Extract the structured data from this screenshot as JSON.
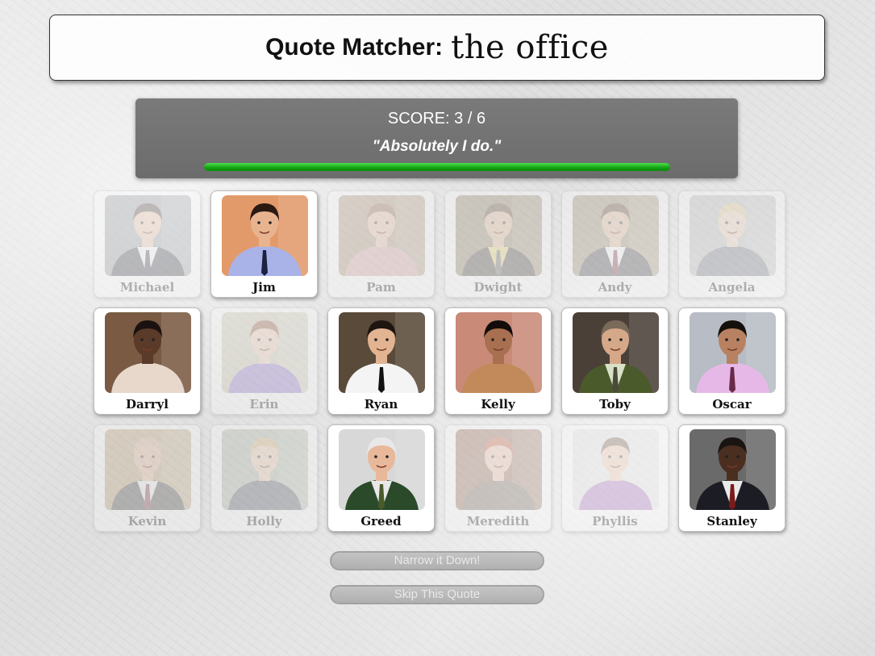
{
  "header": {
    "title_prefix": "Quote Matcher:",
    "title_show": "the office"
  },
  "game": {
    "score": "SCORE: 3 / 6",
    "quote": "\"Absolutely I do.\"",
    "progress": 1.0
  },
  "characters": [
    {
      "name": "Michael",
      "active": false,
      "bg": "#8a8f96",
      "skin": "#e3b89a",
      "hair": "#3b2a20",
      "shirt": "#f2f2f2",
      "suit": "#2c2f38",
      "tie": "#2a2a3a"
    },
    {
      "name": "Jim",
      "active": true,
      "bg": "#e39a6b",
      "skin": "#e8b48f",
      "hair": "#2a1a12",
      "shirt": "#a9b3e8",
      "suit": "#a9b3e8",
      "tie": "#1c2140"
    },
    {
      "name": "Pam",
      "active": false,
      "bg": "#a58a6c",
      "skin": "#e6b699",
      "hair": "#8a5a3a",
      "shirt": "#d49a9a",
      "suit": "#d49a9a",
      "tie": "#d49a9a"
    },
    {
      "name": "Dwight",
      "active": false,
      "bg": "#8a7a5a",
      "skin": "#e0b48e",
      "hair": "#5a3f25",
      "shirt": "#e8d46a",
      "suit": "#3a342c",
      "tie": "#5a5a5a"
    },
    {
      "name": "Andy",
      "active": false,
      "bg": "#9a8a6a",
      "skin": "#e4b894",
      "hair": "#5a3a24",
      "shirt": "#ffffff",
      "suit": "#3a3a40",
      "tie": "#7a2a3a"
    },
    {
      "name": "Angela",
      "active": false,
      "bg": "#b9b9b9",
      "skin": "#efcdb6",
      "hair": "#e3c98a",
      "shirt": "#6a6f7a",
      "suit": "#6a6f7a",
      "tie": "#6a6f7a"
    },
    {
      "name": "Darryl",
      "active": true,
      "bg": "#7a5a42",
      "skin": "#5a3a28",
      "hair": "#1a1210",
      "shirt": "#e8d8cc",
      "suit": "#e8d8cc",
      "tie": "#e8d8cc"
    },
    {
      "name": "Erin",
      "active": false,
      "bg": "#c7c2a8",
      "skin": "#f0c8ae",
      "hair": "#8a4a2a",
      "shirt": "#8a6ac8",
      "suit": "#8a6ac8",
      "tie": "#8a6ac8"
    },
    {
      "name": "Ryan",
      "active": true,
      "bg": "#5a4a3a",
      "skin": "#e2b492",
      "hair": "#1e1510",
      "shirt": "#f4f4f4",
      "suit": "#f4f4f4",
      "tie": "#111111"
    },
    {
      "name": "Kelly",
      "active": true,
      "bg": "#c98a78",
      "skin": "#a87050",
      "hair": "#120c0a",
      "shirt": "#c28a5a",
      "suit": "#c28a5a",
      "tie": "#c28a5a"
    },
    {
      "name": "Toby",
      "active": true,
      "bg": "#4a4038",
      "skin": "#d6a88a",
      "hair": "#7a6a5a",
      "shirt": "#d8e0c8",
      "suit": "#4a5a2a",
      "tie": "#4a4a3a"
    },
    {
      "name": "Oscar",
      "active": true,
      "bg": "#b8bcc4",
      "skin": "#b88262",
      "hair": "#15100c",
      "shirt": "#e6b8e8",
      "suit": "#e6b8e8",
      "tie": "#6a2a4a"
    },
    {
      "name": "Kevin",
      "active": false,
      "bg": "#b89a6a",
      "skin": "#e2b08c",
      "hair": "#d6a888",
      "shirt": "#f0f0f0",
      "suit": "#3a3836",
      "tie": "#7a2a3a"
    },
    {
      "name": "Holly",
      "active": false,
      "bg": "#a8b0a0",
      "skin": "#efc8ac",
      "hair": "#d8b070",
      "shirt": "#4a4e5a",
      "suit": "#4a4e5a",
      "tie": "#4a4e5a"
    },
    {
      "name": "Greed",
      "active": true,
      "bg": "#d8d8d8",
      "skin": "#e8b89a",
      "hair": "#e8e8e8",
      "shirt": "#e8e8e8",
      "suit": "#2a4a2a",
      "tie": "#4a5a2a"
    },
    {
      "name": "Meredith",
      "active": false,
      "bg": "#8a5a42",
      "skin": "#eab9a0",
      "hair": "#c2502a",
      "shirt": "#6a5a4a",
      "suit": "#6a5a4a",
      "tie": "#6a5a4a"
    },
    {
      "name": "Phyllis",
      "active": false,
      "bg": "#e0e0e0",
      "skin": "#eec0a4",
      "hair": "#6a4a3a",
      "shirt": "#a064b8",
      "suit": "#a064b8",
      "tie": "#a064b8"
    },
    {
      "name": "Stanley",
      "active": true,
      "bg": "#6a6a6a",
      "skin": "#4a2e20",
      "hair": "#1a1412",
      "shirt": "#eaeaea",
      "suit": "#1c1c24",
      "tie": "#7a1a1a"
    }
  ],
  "buttons": {
    "narrow": "Narrow it Down!",
    "skip": "Skip This Quote"
  }
}
